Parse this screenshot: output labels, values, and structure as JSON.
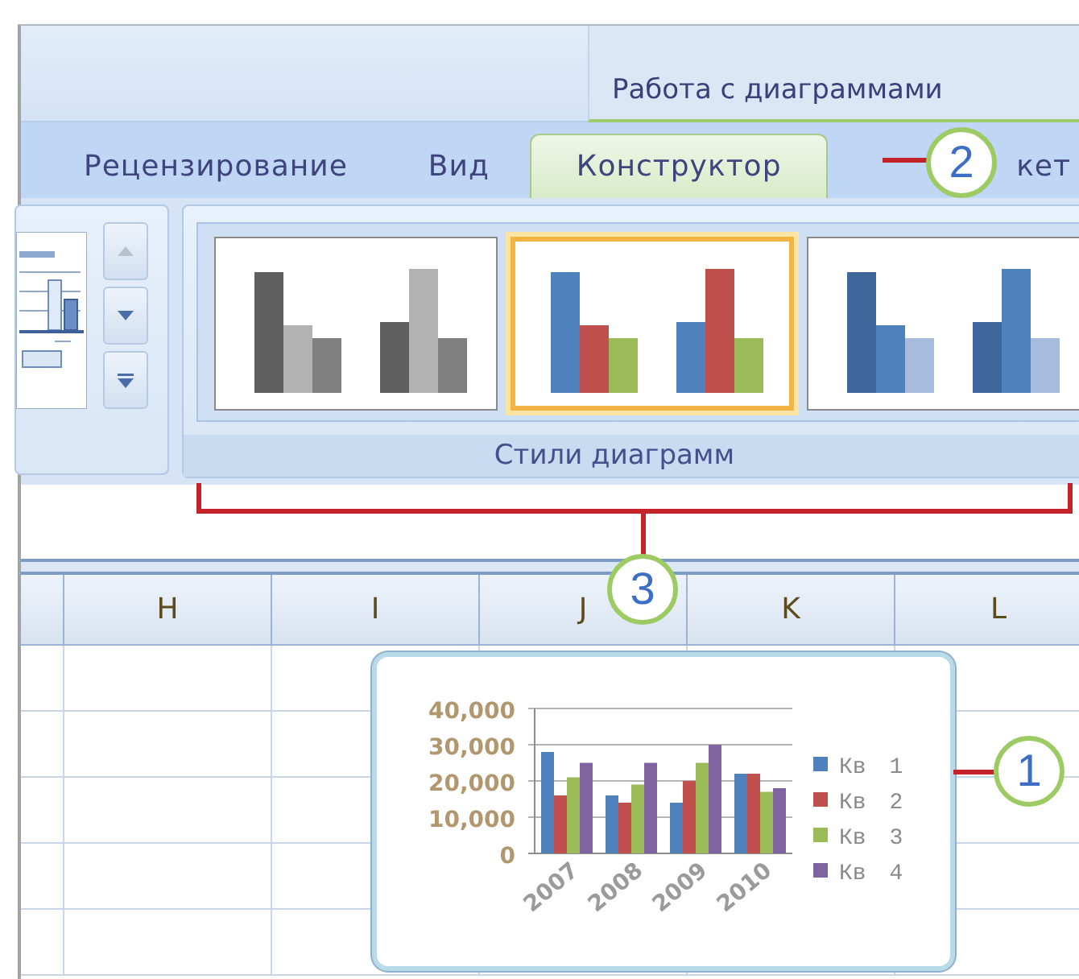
{
  "context_tab_group": {
    "title": "Работа с диаграммами"
  },
  "tabs": [
    {
      "label": "Рецензирование",
      "selected": false
    },
    {
      "label": "Вид",
      "selected": false
    },
    {
      "label": "Конструктор",
      "selected": true
    },
    {
      "label": "кет",
      "selected": false
    }
  ],
  "chart_styles": {
    "label": "Стили диаграмм",
    "items": [
      {
        "selected": false,
        "kind": "grayscale"
      },
      {
        "selected": true,
        "kind": "colorful"
      },
      {
        "selected": false,
        "kind": "blue"
      }
    ]
  },
  "columns": [
    "H",
    "I",
    "J",
    "K",
    "L"
  ],
  "chart": {
    "chart_data": {
      "type": "bar",
      "categories": [
        "2007",
        "2008",
        "2009",
        "2010"
      ],
      "series": [
        {
          "name": "Кв 1",
          "color": "#4f81bd",
          "values": [
            28000,
            16000,
            14000,
            22000
          ]
        },
        {
          "name": "Кв 2",
          "color": "#c0504d",
          "values": [
            16000,
            14000,
            20000,
            22000
          ]
        },
        {
          "name": "Кв 3",
          "color": "#9bbb59",
          "values": [
            21000,
            19000,
            25000,
            17000
          ]
        },
        {
          "name": "Кв 4",
          "color": "#8064a2",
          "values": [
            25000,
            25000,
            30000,
            18000
          ]
        }
      ],
      "ylim": [
        0,
        40000
      ],
      "grid": true,
      "legend": "right",
      "yticks": [
        {
          "value": 0,
          "label": "0"
        },
        {
          "value": 10000,
          "label": "10,000"
        },
        {
          "value": 20000,
          "label": "20,000"
        },
        {
          "value": 30000,
          "label": "30,000"
        },
        {
          "value": 40000,
          "label": "40,000"
        }
      ]
    }
  },
  "callouts": {
    "chart": "1",
    "tab": "2",
    "styles": "3"
  }
}
